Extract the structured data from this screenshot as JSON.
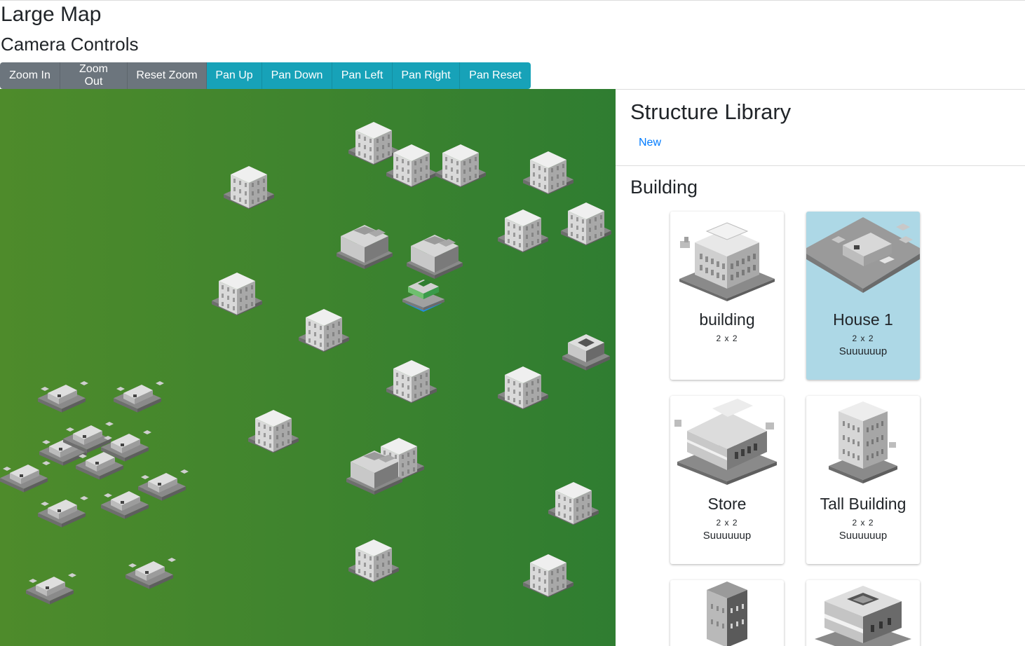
{
  "page": {
    "title": "Large Map",
    "subtitle": "Camera Controls"
  },
  "camera_controls": {
    "zoom_in": "Zoom In",
    "zoom_out": "Zoom Out",
    "reset_zoom": "Reset Zoom",
    "pan_up": "Pan Up",
    "pan_down": "Pan Down",
    "pan_left": "Pan Left",
    "pan_right": "Pan Right",
    "pan_reset": "Pan Reset"
  },
  "colors": {
    "zoom_buttons": "#6c757d",
    "pan_buttons": "#17a2b8",
    "map_green": "#2f7d31",
    "selected_card": "#add8e6",
    "link": "#007bff"
  },
  "library": {
    "title": "Structure Library",
    "new_link": "New",
    "section": "Building",
    "cards": [
      {
        "name": "building",
        "size": "2 x 2",
        "desc": "",
        "icon": "office-building-icon",
        "selected": false
      },
      {
        "name": "House 1",
        "size": "2 x 2",
        "desc": "Suuuuuup",
        "icon": "house-icon",
        "selected": true
      },
      {
        "name": "Store",
        "size": "2 x 2",
        "desc": "Suuuuuup",
        "icon": "store-icon",
        "selected": false
      },
      {
        "name": "Tall Building",
        "size": "2 x 2",
        "desc": "Suuuuuup",
        "icon": "tall-building-icon",
        "selected": false
      },
      {
        "name": "",
        "size": "",
        "desc": "",
        "icon": "tower-icon",
        "selected": false
      },
      {
        "name": "",
        "size": "",
        "desc": "",
        "icon": "shop-icon",
        "selected": false
      }
    ]
  },
  "map": {
    "structures": [
      "tall-building",
      "tall-building",
      "tall-building",
      "tall-building",
      "tall-building",
      "tall-building",
      "tall-building",
      "tall-building",
      "tall-building",
      "tall-building",
      "tall-building",
      "tall-building",
      "tall-building",
      "tall-building",
      "tall-building",
      "tall-building",
      "house",
      "house",
      "house",
      "house",
      "house",
      "house",
      "house",
      "house",
      "house",
      "house",
      "house",
      "house",
      "store",
      "store",
      "store",
      "shop",
      "selected-structure"
    ]
  }
}
